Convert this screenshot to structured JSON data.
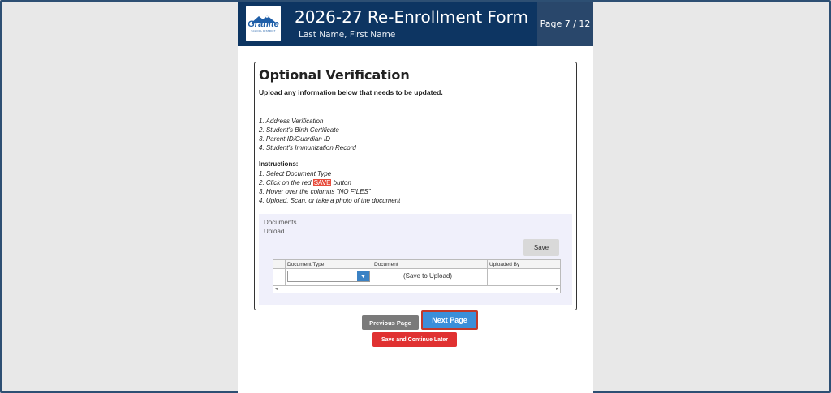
{
  "header": {
    "logo_text": "Granite",
    "logo_subtext": "SCHOOL DISTRICT",
    "title": "2026-27 Re-Enrollment Form",
    "student_name": "Last Name, First Name",
    "page_indicator": "Page 7 / 12"
  },
  "section": {
    "heading": "Optional Verification",
    "intro": "Upload any information below that needs to be updated.",
    "items": [
      "1.  Address Verification",
      "2.  Student's Birth Certificate",
      "3.  Parent ID/Guardian ID",
      "4.  Student's Immunization Record"
    ],
    "instructions_title": "Instructions:",
    "instructions": {
      "step1": "1.  Select Document Type",
      "step2_prefix": "2.  Click on the red ",
      "step2_highlight": "SAVE",
      "step2_suffix": " button",
      "step3": "3.  Hover over the columns \"NO FILES\"",
      "step4": "4.  Upload, Scan, or take a photo of the document"
    }
  },
  "documents": {
    "label_line1": "Documents",
    "label_line2": "Upload",
    "save_label": "Save",
    "columns": [
      "Document Type",
      "Document",
      "Uploaded By"
    ],
    "row_document": "(Save to Upload)",
    "select_value": ""
  },
  "nav": {
    "previous_label": "Previous Page",
    "next_label": "Next Page",
    "later_label": "Save and Continue Later"
  },
  "colors": {
    "header_bg": "#0d3562",
    "page_indicator_bg": "#29476b",
    "next_button": "#3a8fd9",
    "later_button": "#e03131",
    "highlight": "#e74c3c"
  }
}
